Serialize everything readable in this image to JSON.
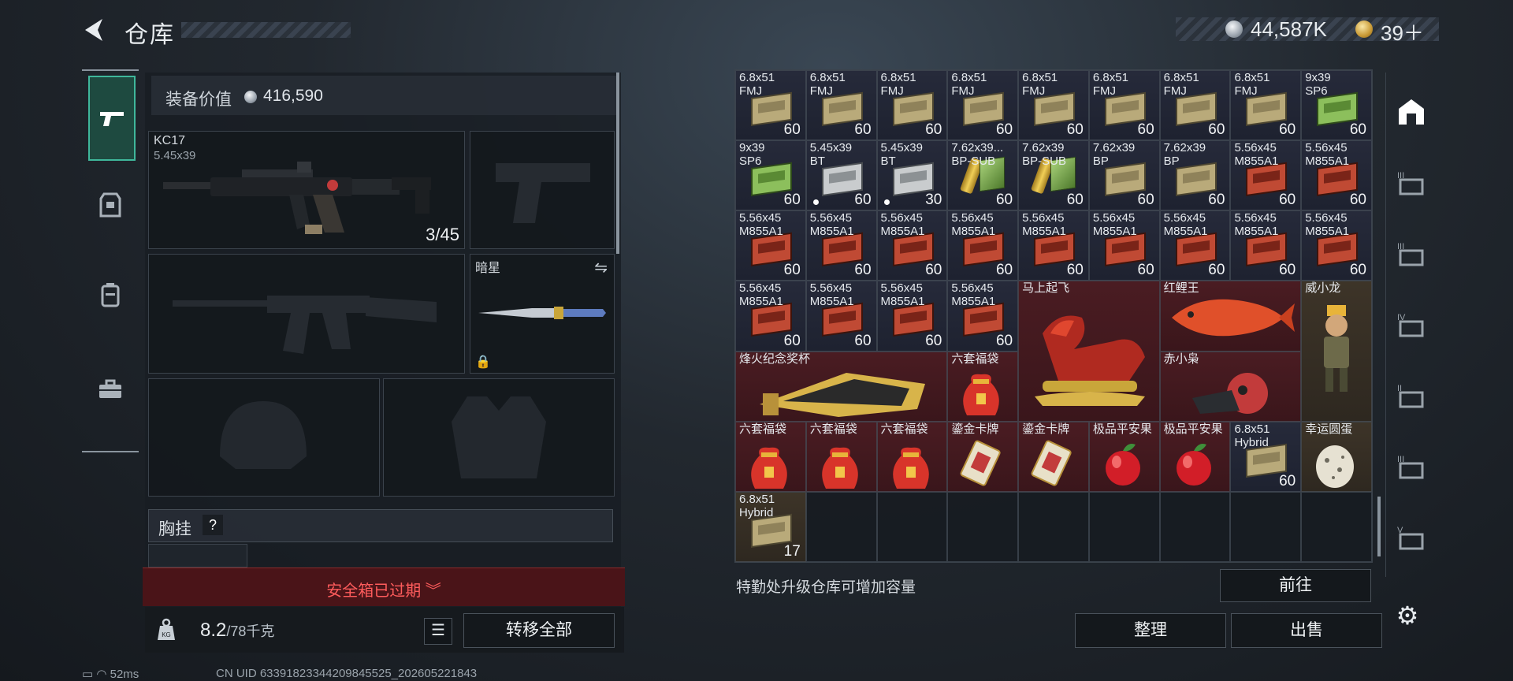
{
  "header": {
    "title": "仓库",
    "silver": "44,587K",
    "gold": "39＋"
  },
  "equipment": {
    "value_label": "装备价值",
    "value": "416,590",
    "primary": {
      "name": "KC17",
      "caliber": "5.45x39",
      "ammo": "3/45"
    },
    "melee": {
      "name": "暗星"
    },
    "chest_label": "胸挂",
    "chest_help": "?",
    "safe_box_status": "安全箱已过期",
    "weight": "8.2",
    "weight_max": "/78千克",
    "transfer_all": "转移全部"
  },
  "warehouse": {
    "cells": [
      {
        "label": "6.8x51\nFMJ",
        "count": "60",
        "type": "ammo",
        "icon": "tan"
      },
      {
        "label": "6.8x51\nFMJ",
        "count": "60",
        "type": "ammo",
        "icon": "tan"
      },
      {
        "label": "6.8x51\nFMJ",
        "count": "60",
        "type": "ammo",
        "icon": "tan"
      },
      {
        "label": "6.8x51\nFMJ",
        "count": "60",
        "type": "ammo",
        "icon": "tan"
      },
      {
        "label": "6.8x51\nFMJ",
        "count": "60",
        "type": "ammo",
        "icon": "tan"
      },
      {
        "label": "6.8x51\nFMJ",
        "count": "60",
        "type": "ammo",
        "icon": "tan"
      },
      {
        "label": "6.8x51\nFMJ",
        "count": "60",
        "type": "ammo",
        "icon": "tan"
      },
      {
        "label": "6.8x51\nFMJ",
        "count": "60",
        "type": "ammo",
        "icon": "tan"
      },
      {
        "label": "9x39\nSP6",
        "count": "60",
        "type": "ammo",
        "icon": "green"
      },
      {
        "label": "9x39\nSP6",
        "count": "60",
        "type": "ammo",
        "icon": "green"
      },
      {
        "label": "5.45x39\nBT",
        "count": "60",
        "type": "ammo",
        "icon": "grey",
        "dot": true
      },
      {
        "label": "5.45x39\nBT",
        "count": "30",
        "type": "ammo",
        "icon": "grey",
        "dot": true
      },
      {
        "label": "7.62x39...\nBP-SUB",
        "count": "60",
        "type": "ammo",
        "icon": "shell"
      },
      {
        "label": "7.62x39\nBP-SUB",
        "count": "60",
        "type": "ammo",
        "icon": "shell"
      },
      {
        "label": "7.62x39\nBP",
        "count": "60",
        "type": "ammo",
        "icon": "tan"
      },
      {
        "label": "7.62x39\nBP",
        "count": "60",
        "type": "ammo",
        "icon": "tan"
      },
      {
        "label": "5.56x45\nM855A1",
        "count": "60",
        "type": "ammo",
        "icon": "redb"
      },
      {
        "label": "5.56x45\nM855A1",
        "count": "60",
        "type": "ammo",
        "icon": "redb"
      },
      {
        "label": "5.56x45\nM855A1",
        "count": "60",
        "type": "ammo",
        "icon": "redb"
      },
      {
        "label": "5.56x45\nM855A1",
        "count": "60",
        "type": "ammo",
        "icon": "redb"
      },
      {
        "label": "5.56x45\nM855A1",
        "count": "60",
        "type": "ammo",
        "icon": "redb"
      },
      {
        "label": "5.56x45\nM855A1",
        "count": "60",
        "type": "ammo",
        "icon": "redb"
      },
      {
        "label": "5.56x45\nM855A1",
        "count": "60",
        "type": "ammo",
        "icon": "redb"
      },
      {
        "label": "5.56x45\nM855A1",
        "count": "60",
        "type": "ammo",
        "icon": "redb"
      },
      {
        "label": "5.56x45\nM855A1",
        "count": "60",
        "type": "ammo",
        "icon": "redb"
      },
      {
        "label": "5.56x45\nM855A1",
        "count": "60",
        "type": "ammo",
        "icon": "redb"
      },
      {
        "label": "5.56x45\nM855A1",
        "count": "60",
        "type": "ammo",
        "icon": "redb"
      },
      {
        "label": "5.56x45\nM855A1",
        "count": "60",
        "type": "ammo",
        "icon": "redb"
      },
      {
        "label": "5.56x45\nM855A1",
        "count": "60",
        "type": "ammo",
        "icon": "redb"
      },
      {
        "label": "5.56x45\nM855A1",
        "count": "60",
        "type": "ammo",
        "icon": "redb"
      },
      {
        "label": "5.56x45\nM855A1",
        "count": "60",
        "type": "ammo",
        "icon": "redb"
      }
    ],
    "big_items": [
      {
        "label": "马上起飞",
        "icon": "horse"
      },
      {
        "label": "红鲤王",
        "icon": "carp"
      },
      {
        "label": "威小龙",
        "icon": "figure"
      },
      {
        "label": "烽火纪念奖杯",
        "icon": "trophy"
      },
      {
        "label": "六套福袋",
        "icon": "lucky-bag"
      },
      {
        "label": "赤小枭",
        "icon": "owl"
      }
    ],
    "row6": [
      {
        "label": "六套福袋",
        "icon": "lucky-bag"
      },
      {
        "label": "六套福袋",
        "icon": "lucky-bag"
      },
      {
        "label": "六套福袋",
        "icon": "lucky-bag"
      },
      {
        "label": "鎏金卡牌",
        "icon": "card"
      },
      {
        "label": "鎏金卡牌",
        "icon": "card"
      },
      {
        "label": "极品平安果",
        "icon": "apple"
      },
      {
        "label": "极品平安果",
        "icon": "apple"
      },
      {
        "label": "6.8x51\nHybrid",
        "count": "60",
        "icon": "tan"
      },
      {
        "label": "幸运圆蛋",
        "icon": "egg"
      }
    ],
    "row7": [
      {
        "label": "6.8x51\nHybrid",
        "count": "17",
        "icon": "tan"
      }
    ],
    "upgrade_note": "特勤处升级仓库可增加容量",
    "goto": "前往",
    "sort": "整理",
    "sell": "出售"
  },
  "status": {
    "ping": "52ms",
    "uid": "CN UID 633918233442098455​25_202605221843"
  }
}
